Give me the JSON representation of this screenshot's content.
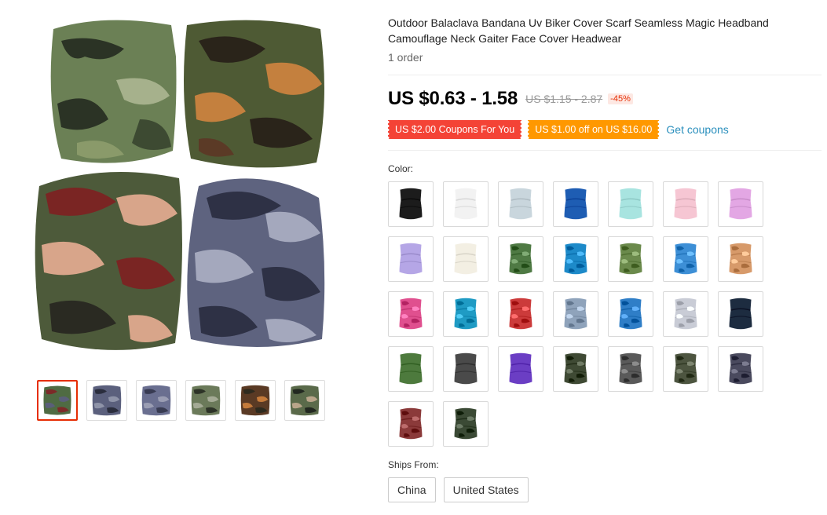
{
  "product": {
    "title": "Outdoor Balaclava Bandana Uv Biker Cover Scarf Seamless Magic Headband Camouflage Neck Gaiter Face Cover Headwear",
    "orders": "1 order",
    "price": "US $0.63 - 1.58",
    "original_price": "US $1.15 - 2.87",
    "discount": "-45%"
  },
  "coupons": {
    "coupon1": "US $2.00 Coupons For You",
    "coupon2": "US $1.00 off on US $16.00",
    "get_coupons": "Get coupons"
  },
  "color": {
    "label": "Color:",
    "options": [
      {
        "color": "#1c1c1c",
        "pattern": "solid"
      },
      {
        "color": "#f2f2f2",
        "pattern": "solid"
      },
      {
        "color": "#c9d6dd",
        "pattern": "solid"
      },
      {
        "color": "#1e5db3",
        "pattern": "solid"
      },
      {
        "color": "#a8e4e0",
        "pattern": "solid"
      },
      {
        "color": "#f6c6d3",
        "pattern": "solid"
      },
      {
        "color": "#e3a7e4",
        "pattern": "solid"
      },
      {
        "color": "#b5a6e6",
        "pattern": "solid"
      },
      {
        "color": "#f3efe3",
        "pattern": "solid"
      },
      {
        "color": "#4f7a44",
        "pattern": "camo"
      },
      {
        "color": "#1d8ac9",
        "pattern": "camo"
      },
      {
        "color": "#6b8a4c",
        "pattern": "camo"
      },
      {
        "color": "#3d8fd6",
        "pattern": "camo"
      },
      {
        "color": "#d79a6a",
        "pattern": "camo"
      },
      {
        "color": "#e0508f",
        "pattern": "camo"
      },
      {
        "color": "#1f9bc4",
        "pattern": "camo"
      },
      {
        "color": "#cc3b3b",
        "pattern": "camo"
      },
      {
        "color": "#8fa3bb",
        "pattern": "camo"
      },
      {
        "color": "#2f7ec7",
        "pattern": "camo"
      },
      {
        "color": "#c9ccd6",
        "pattern": "camo"
      },
      {
        "color": "#1d2c40",
        "pattern": "solid"
      },
      {
        "color": "#4d7a3d",
        "pattern": "solid"
      },
      {
        "color": "#4a4a4a",
        "pattern": "solid"
      },
      {
        "color": "#6b3ec4",
        "pattern": "solid"
      },
      {
        "color": "#3f4a34",
        "pattern": "camo"
      },
      {
        "color": "#5a5a5a",
        "pattern": "camo"
      },
      {
        "color": "#4d5540",
        "pattern": "camo"
      },
      {
        "color": "#4a4a5e",
        "pattern": "camo"
      },
      {
        "color": "#8b3a3a",
        "pattern": "camo"
      },
      {
        "color": "#3b4a35",
        "pattern": "camo"
      }
    ]
  },
  "shipping": {
    "label": "Ships From:",
    "options": [
      "China",
      "United States"
    ]
  },
  "gallery": {
    "thumbnails": [
      {
        "colors": [
          "#4f6b43",
          "#7d2a28",
          "#5a5f7a",
          "#8a6a3a"
        ]
      },
      {
        "colors": [
          "#5b607d",
          "#2a2d3d",
          "#8e93a8",
          "#5b607d"
        ]
      },
      {
        "colors": [
          "#6a6f90",
          "#383b52",
          "#9a9db3",
          "#6a6f90"
        ]
      },
      {
        "colors": [
          "#6b7a5a",
          "#2d3327",
          "#a4aa95",
          "#6b7a5a"
        ]
      },
      {
        "colors": [
          "#5a3a24",
          "#2e2a1e",
          "#c47a3a",
          "#54643b"
        ]
      },
      {
        "colors": [
          "#5a6a4a",
          "#222820",
          "#b9a58a",
          "#5a6a4a"
        ]
      }
    ]
  }
}
